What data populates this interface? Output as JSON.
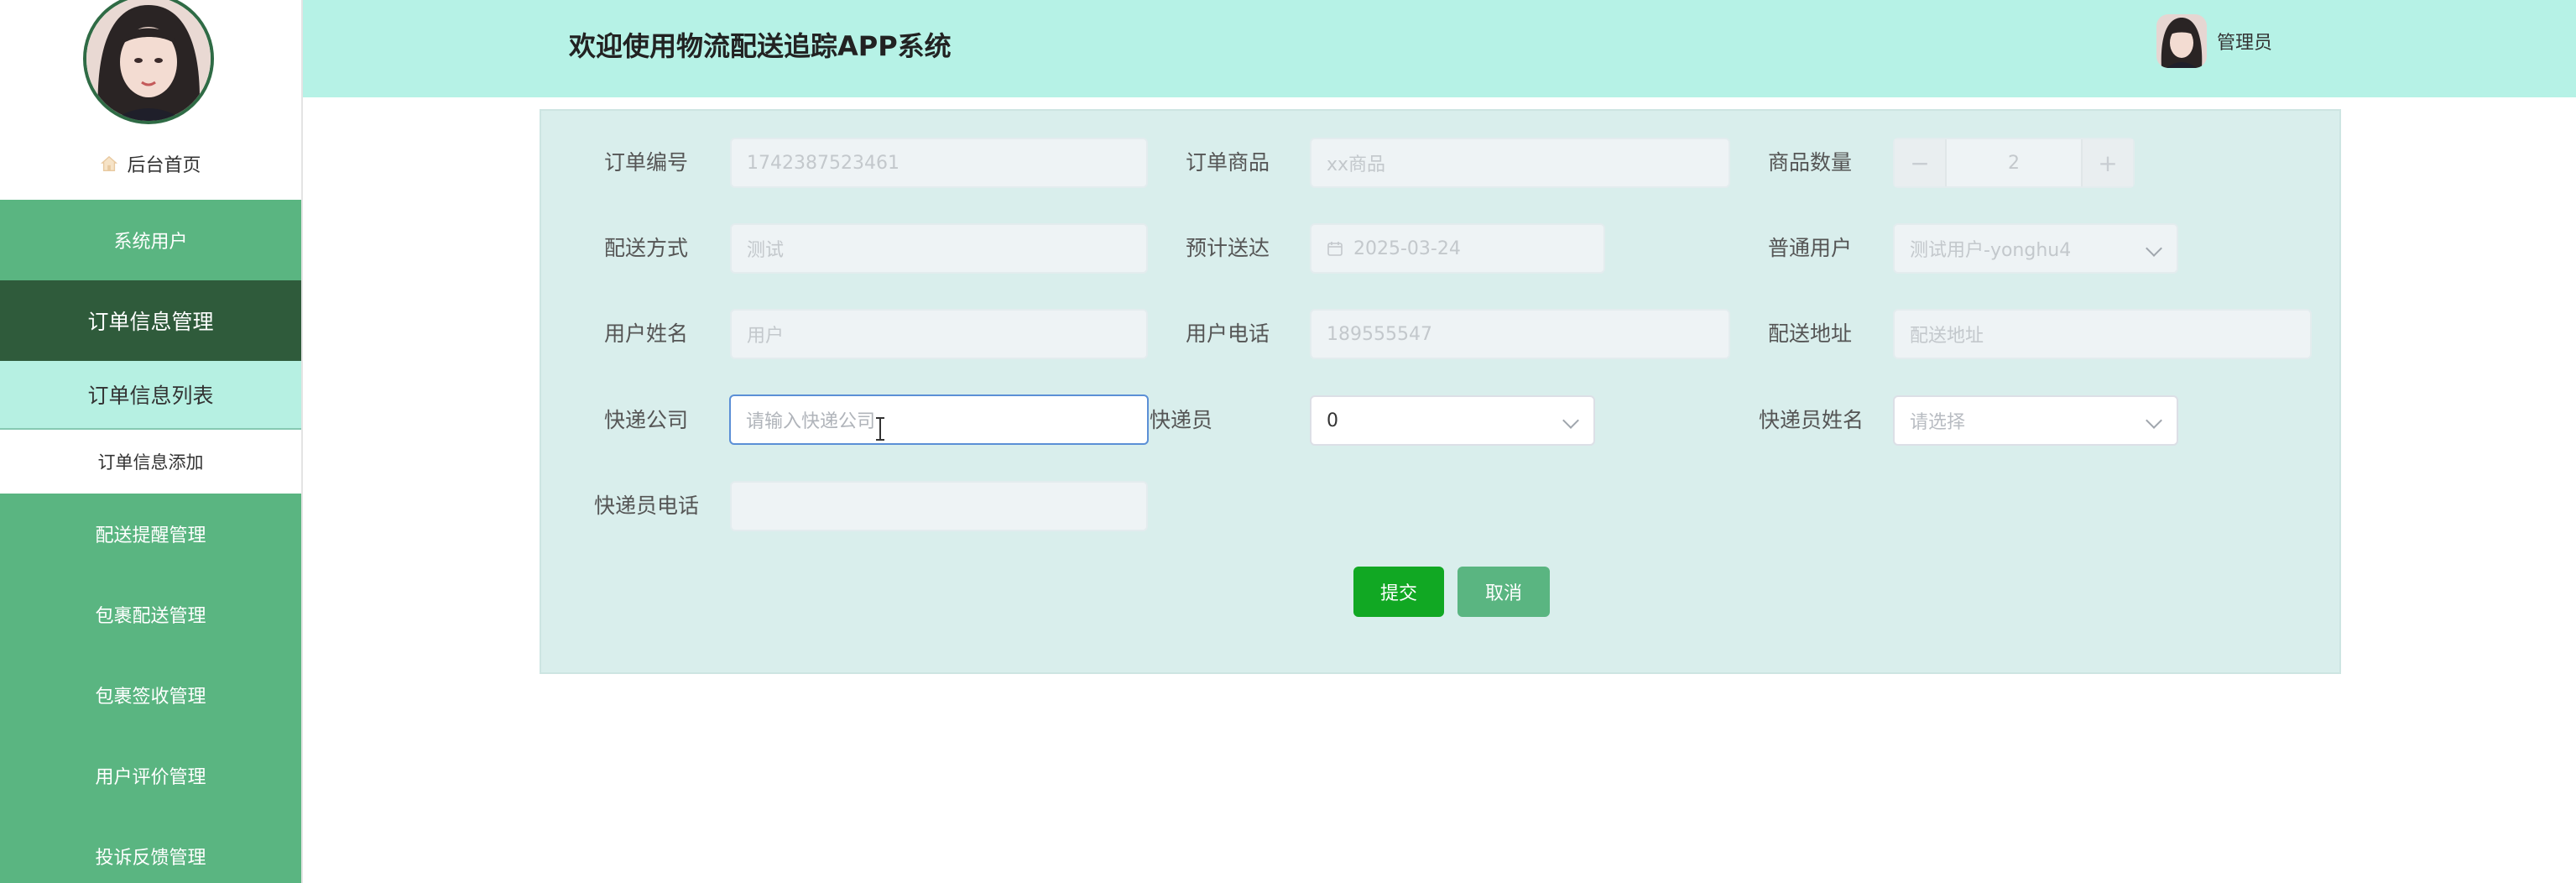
{
  "sidebar": {
    "home_label": "后台首页",
    "menu": [
      {
        "label": "系统用户"
      },
      {
        "label": "订单信息管理"
      },
      {
        "label": "订单信息列表"
      },
      {
        "label": "订单信息添加"
      },
      {
        "label": "配送提醒管理"
      },
      {
        "label": "包裹配送管理"
      },
      {
        "label": "包裹签收管理"
      },
      {
        "label": "用户评价管理"
      },
      {
        "label": "投诉反馈管理"
      }
    ]
  },
  "header": {
    "title": "欢迎使用物流配送追踪APP系统",
    "user_name": "管理员"
  },
  "form": {
    "order_no": {
      "label": "订单编号",
      "value": "1742387523461"
    },
    "order_goods": {
      "label": "订单商品",
      "placeholder": "xx商品"
    },
    "goods_qty": {
      "label": "商品数量",
      "value": "2",
      "minus": "−",
      "plus": "+"
    },
    "delivery_method": {
      "label": "配送方式",
      "value": "测试"
    },
    "expected_date": {
      "label": "预计送达",
      "value": "2025-03-24"
    },
    "normal_user": {
      "label": "普通用户",
      "value": "测试用户-yonghu4"
    },
    "user_name": {
      "label": "用户姓名",
      "value": "用户"
    },
    "user_phone": {
      "label": "用户电话",
      "value": "189555547"
    },
    "delivery_address": {
      "label": "配送地址",
      "placeholder": "配送地址"
    },
    "express_company": {
      "label": "快递公司",
      "placeholder": "请输入快递公司"
    },
    "courier": {
      "label": "快递员",
      "value": "0"
    },
    "courier_name": {
      "label": "快递员姓名",
      "placeholder": "请选择"
    },
    "courier_phone": {
      "label": "快递员电话",
      "value": ""
    },
    "submit_label": "提交",
    "cancel_label": "取消"
  },
  "colors": {
    "sidebar_green": "#5ab581",
    "sidebar_dark": "#2f5b3b",
    "sub_active": "#b6f0e2",
    "header_bg": "#b6f2e6",
    "panel_bg": "#d9eeec",
    "submit_green": "#11a823"
  }
}
